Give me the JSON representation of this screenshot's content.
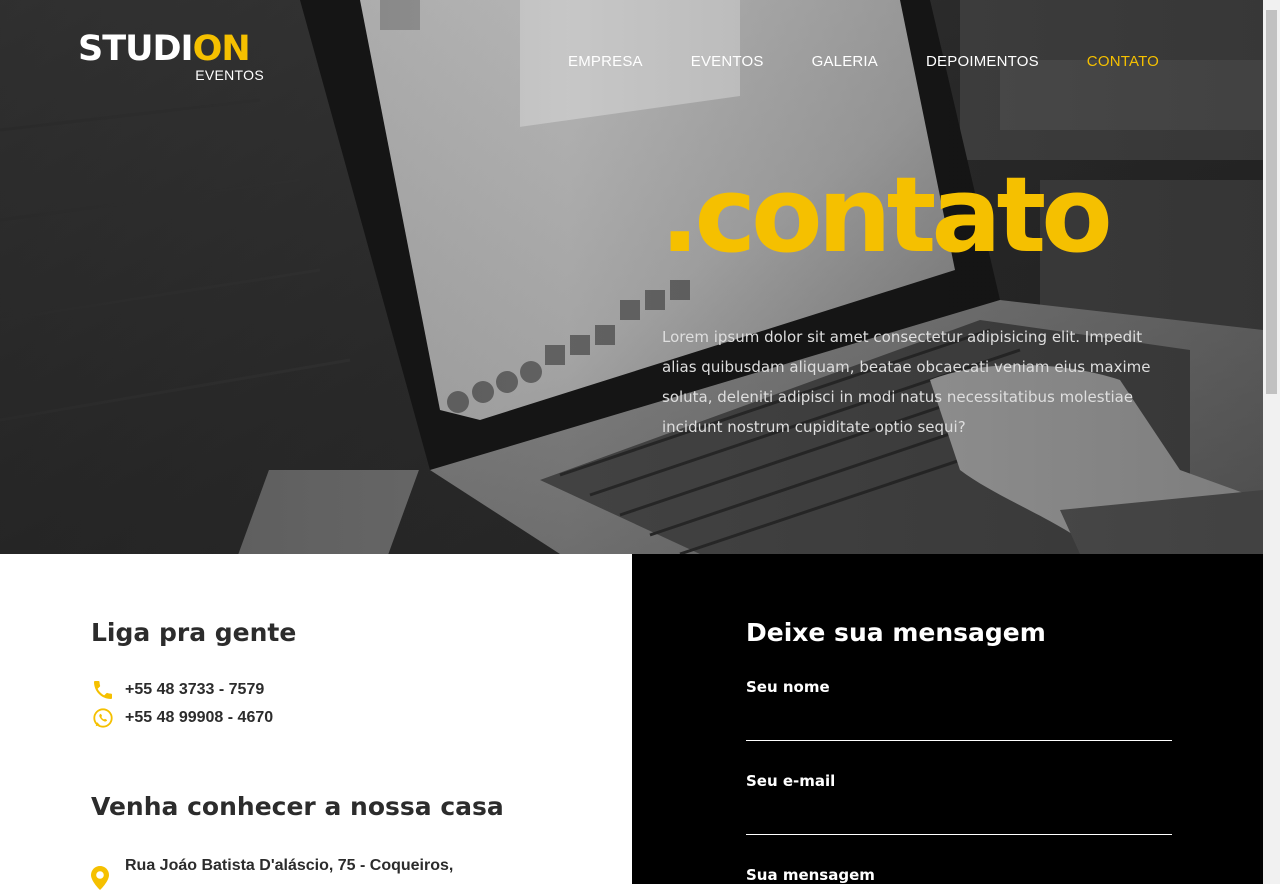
{
  "header": {
    "logo": {
      "part1": "STUDI",
      "part2": "ON",
      "subtitle": "EVENTOS"
    },
    "nav": [
      {
        "label": "EMPRESA",
        "active": false
      },
      {
        "label": "EVENTOS",
        "active": false
      },
      {
        "label": "GALERIA",
        "active": false
      },
      {
        "label": "DEPOIMENTOS",
        "active": false
      },
      {
        "label": "CONTATO",
        "active": true
      }
    ]
  },
  "hero": {
    "title": ".contato",
    "text": "Lorem ipsum dolor sit amet consectetur adipisicing elit. Impedit alias quibusdam aliquam, beatae obcaecati veniam eius maxime soluta, deleniti adipisci in modi natus necessitatibus molestiae incidunt nostrum cupiditate optio sequi?",
    "background": "laptop-keyboard-photo"
  },
  "contact": {
    "phone_heading": "Liga pra gente",
    "phones": [
      {
        "icon": "phone-icon",
        "number": "+55 48 3733 - 7579"
      },
      {
        "icon": "whatsapp-icon",
        "number": "+55 48 99908 - 4670"
      }
    ],
    "address_heading": "Venha conhecer a nossa casa",
    "address": {
      "icon": "location-pin-icon",
      "line1": "Rua Joáo Batista D'aláscio, 75 - Coqueiros,"
    }
  },
  "form": {
    "heading": "Deixe sua mensagem",
    "name_label": "Seu nome",
    "name_value": "",
    "email_label": "Seu e-mail",
    "email_value": "",
    "message_label": "Sua mensagem"
  },
  "colors": {
    "accent": "#f5c000",
    "dark_text": "#2c2c2c",
    "form_bg": "#000000"
  }
}
